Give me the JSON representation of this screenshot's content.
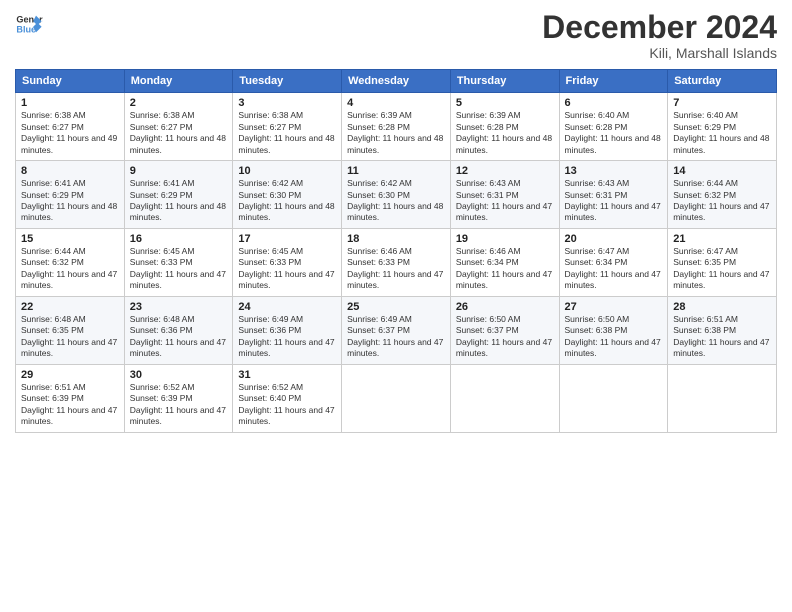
{
  "header": {
    "logo_line1": "General",
    "logo_line2": "Blue",
    "title": "December 2024",
    "subtitle": "Kili, Marshall Islands"
  },
  "days_of_week": [
    "Sunday",
    "Monday",
    "Tuesday",
    "Wednesday",
    "Thursday",
    "Friday",
    "Saturday"
  ],
  "weeks": [
    [
      {
        "day": 1,
        "sunrise": "6:38 AM",
        "sunset": "6:27 PM",
        "daylight": "11 hours and 49 minutes."
      },
      {
        "day": 2,
        "sunrise": "6:38 AM",
        "sunset": "6:27 PM",
        "daylight": "11 hours and 48 minutes."
      },
      {
        "day": 3,
        "sunrise": "6:38 AM",
        "sunset": "6:27 PM",
        "daylight": "11 hours and 48 minutes."
      },
      {
        "day": 4,
        "sunrise": "6:39 AM",
        "sunset": "6:28 PM",
        "daylight": "11 hours and 48 minutes."
      },
      {
        "day": 5,
        "sunrise": "6:39 AM",
        "sunset": "6:28 PM",
        "daylight": "11 hours and 48 minutes."
      },
      {
        "day": 6,
        "sunrise": "6:40 AM",
        "sunset": "6:28 PM",
        "daylight": "11 hours and 48 minutes."
      },
      {
        "day": 7,
        "sunrise": "6:40 AM",
        "sunset": "6:29 PM",
        "daylight": "11 hours and 48 minutes."
      }
    ],
    [
      {
        "day": 8,
        "sunrise": "6:41 AM",
        "sunset": "6:29 PM",
        "daylight": "11 hours and 48 minutes."
      },
      {
        "day": 9,
        "sunrise": "6:41 AM",
        "sunset": "6:29 PM",
        "daylight": "11 hours and 48 minutes."
      },
      {
        "day": 10,
        "sunrise": "6:42 AM",
        "sunset": "6:30 PM",
        "daylight": "11 hours and 48 minutes."
      },
      {
        "day": 11,
        "sunrise": "6:42 AM",
        "sunset": "6:30 PM",
        "daylight": "11 hours and 48 minutes."
      },
      {
        "day": 12,
        "sunrise": "6:43 AM",
        "sunset": "6:31 PM",
        "daylight": "11 hours and 47 minutes."
      },
      {
        "day": 13,
        "sunrise": "6:43 AM",
        "sunset": "6:31 PM",
        "daylight": "11 hours and 47 minutes."
      },
      {
        "day": 14,
        "sunrise": "6:44 AM",
        "sunset": "6:32 PM",
        "daylight": "11 hours and 47 minutes."
      }
    ],
    [
      {
        "day": 15,
        "sunrise": "6:44 AM",
        "sunset": "6:32 PM",
        "daylight": "11 hours and 47 minutes."
      },
      {
        "day": 16,
        "sunrise": "6:45 AM",
        "sunset": "6:33 PM",
        "daylight": "11 hours and 47 minutes."
      },
      {
        "day": 17,
        "sunrise": "6:45 AM",
        "sunset": "6:33 PM",
        "daylight": "11 hours and 47 minutes."
      },
      {
        "day": 18,
        "sunrise": "6:46 AM",
        "sunset": "6:33 PM",
        "daylight": "11 hours and 47 minutes."
      },
      {
        "day": 19,
        "sunrise": "6:46 AM",
        "sunset": "6:34 PM",
        "daylight": "11 hours and 47 minutes."
      },
      {
        "day": 20,
        "sunrise": "6:47 AM",
        "sunset": "6:34 PM",
        "daylight": "11 hours and 47 minutes."
      },
      {
        "day": 21,
        "sunrise": "6:47 AM",
        "sunset": "6:35 PM",
        "daylight": "11 hours and 47 minutes."
      }
    ],
    [
      {
        "day": 22,
        "sunrise": "6:48 AM",
        "sunset": "6:35 PM",
        "daylight": "11 hours and 47 minutes."
      },
      {
        "day": 23,
        "sunrise": "6:48 AM",
        "sunset": "6:36 PM",
        "daylight": "11 hours and 47 minutes."
      },
      {
        "day": 24,
        "sunrise": "6:49 AM",
        "sunset": "6:36 PM",
        "daylight": "11 hours and 47 minutes."
      },
      {
        "day": 25,
        "sunrise": "6:49 AM",
        "sunset": "6:37 PM",
        "daylight": "11 hours and 47 minutes."
      },
      {
        "day": 26,
        "sunrise": "6:50 AM",
        "sunset": "6:37 PM",
        "daylight": "11 hours and 47 minutes."
      },
      {
        "day": 27,
        "sunrise": "6:50 AM",
        "sunset": "6:38 PM",
        "daylight": "11 hours and 47 minutes."
      },
      {
        "day": 28,
        "sunrise": "6:51 AM",
        "sunset": "6:38 PM",
        "daylight": "11 hours and 47 minutes."
      }
    ],
    [
      {
        "day": 29,
        "sunrise": "6:51 AM",
        "sunset": "6:39 PM",
        "daylight": "11 hours and 47 minutes."
      },
      {
        "day": 30,
        "sunrise": "6:52 AM",
        "sunset": "6:39 PM",
        "daylight": "11 hours and 47 minutes."
      },
      {
        "day": 31,
        "sunrise": "6:52 AM",
        "sunset": "6:40 PM",
        "daylight": "11 hours and 47 minutes."
      },
      null,
      null,
      null,
      null
    ]
  ]
}
